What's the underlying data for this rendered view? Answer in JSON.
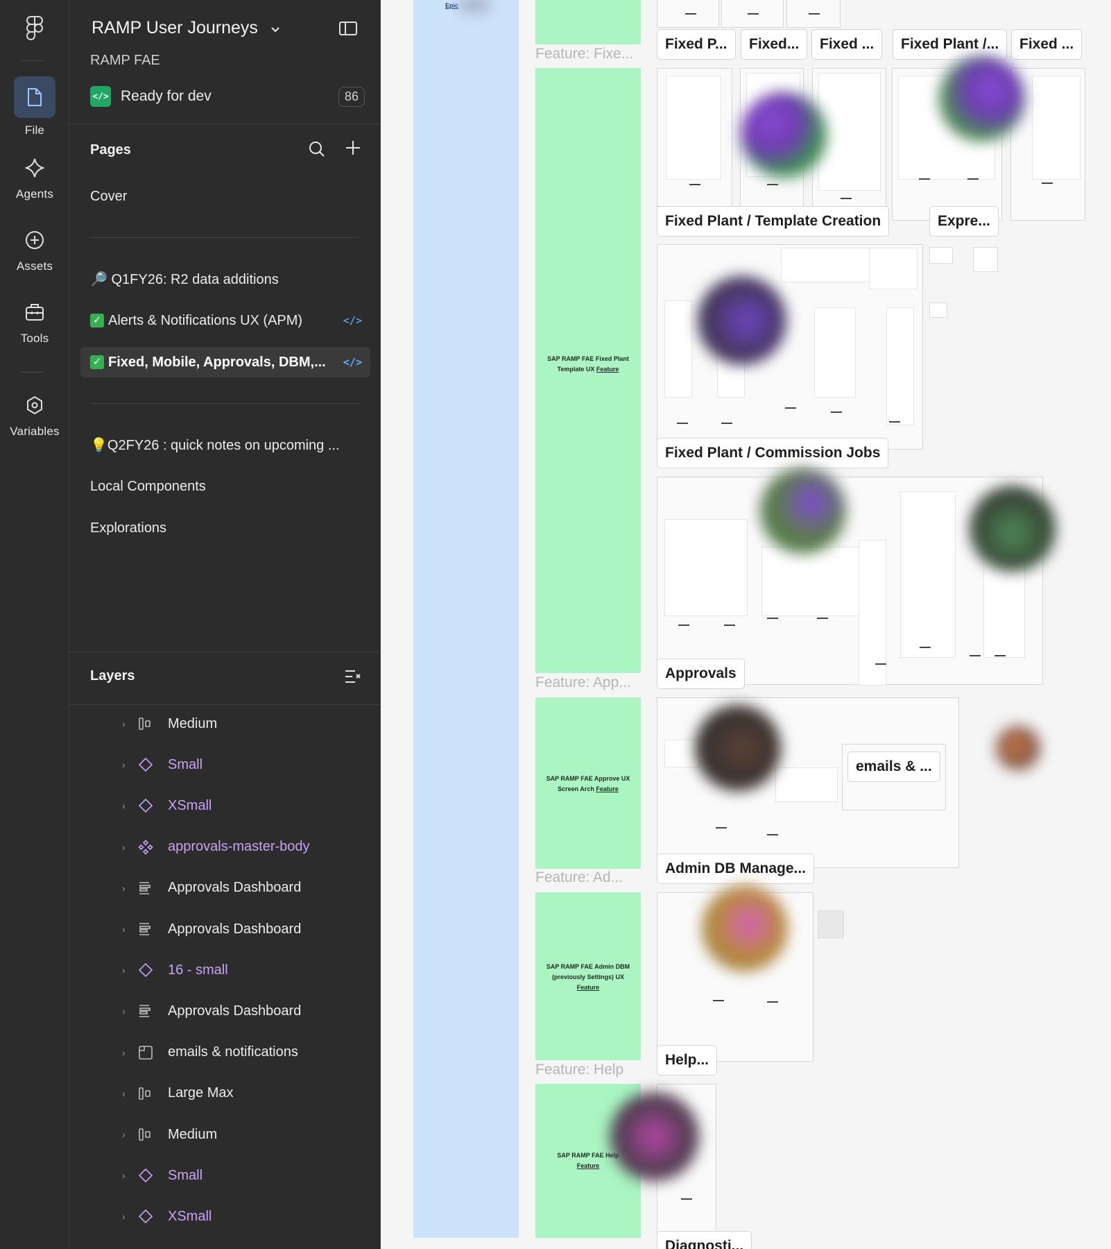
{
  "rail": {
    "items": [
      {
        "label": "File",
        "icon": "file-icon"
      },
      {
        "label": "Agents",
        "icon": "agents-sparkle-icon"
      },
      {
        "label": "Assets",
        "icon": "assets-plus-icon"
      },
      {
        "label": "Tools",
        "icon": "tools-briefcase-icon"
      },
      {
        "label": "Variables",
        "icon": "variables-hexagon-icon"
      }
    ]
  },
  "panel": {
    "project_title": "RAMP User Journeys",
    "team": "RAMP FAE",
    "status_label": "Ready for dev",
    "status_count": "86",
    "pages_header": "Pages",
    "layers_header": "Layers",
    "pages": [
      {
        "label": "Cover"
      },
      {
        "label": "🔎 Q1FY26: R2 data additions"
      },
      {
        "label": "Alerts & Notifications UX (APM)"
      },
      {
        "label": "Fixed, Mobile, Approvals, DBM,..."
      },
      {
        "label": "💡Q2FY26 : quick notes on upcoming ..."
      },
      {
        "label": "Local Components"
      },
      {
        "label": "Explorations"
      }
    ],
    "layers": [
      {
        "label": "Medium",
        "icon": "frame-variant-icon",
        "component": false
      },
      {
        "label": "Small",
        "icon": "component-instance-icon",
        "component": true
      },
      {
        "label": "XSmall",
        "icon": "component-instance-icon",
        "component": true
      },
      {
        "label": "approvals-master-body",
        "icon": "component-set-icon",
        "component": true
      },
      {
        "label": "Approvals Dashboard",
        "icon": "autolayout-icon",
        "component": false
      },
      {
        "label": "Approvals Dashboard",
        "icon": "autolayout-icon",
        "component": false
      },
      {
        "label": "16 - small",
        "icon": "component-instance-icon",
        "component": true
      },
      {
        "label": "Approvals Dashboard",
        "icon": "autolayout-icon",
        "component": false
      },
      {
        "label": "emails & notifications",
        "icon": "section-icon",
        "component": false
      },
      {
        "label": "Large Max",
        "icon": "frame-variant-icon",
        "component": false
      },
      {
        "label": "Medium",
        "icon": "frame-variant-icon",
        "component": false
      },
      {
        "label": "Small",
        "icon": "component-instance-icon",
        "component": true
      },
      {
        "label": "XSmall",
        "icon": "component-instance-icon",
        "component": true
      }
    ]
  },
  "canvas": {
    "epic_label": "Epic",
    "feature_labels": [
      "Feature: Fixe...",
      "Feature: App...",
      "Feature: Ad...",
      "Feature: Help"
    ],
    "feature_blocks": [
      {
        "line1": "SAP RAMP FAE Fixed Plant",
        "line2": "Template UX",
        "link": "Feature"
      },
      {
        "line1": "SAP RAMP FAE Approve UX",
        "line2": "Screen Arch",
        "link": "Feature"
      },
      {
        "line1": "SAP RAMP FAE Admin DBM",
        "line2": "(previously Settings) UX",
        "link": "Feature"
      },
      {
        "line1": "SAP RAMP FAE Help",
        "line2": "",
        "link": "Feature"
      }
    ],
    "frame_titles": {
      "top": [
        "Fixed P...",
        "Fixed...",
        "Fixed ...",
        "Fixed Plant /...",
        "Fixed ..."
      ],
      "template_creation": "Fixed Plant / Template Creation",
      "expre": "Expre...",
      "commission_jobs": "Fixed Plant / Commission Jobs",
      "approvals": "Approvals",
      "emails": "emails & ...",
      "admin_db": "Admin DB Manage...",
      "help": "Help...",
      "diagnostics": "Diagnosti..."
    }
  },
  "colors": {
    "rail_bg": "#2c2c2c",
    "active_item": "#3b4a63",
    "ready_green": "#1ea864",
    "component_purple": "#c9a2f5",
    "epic_blue": "#cce3fb",
    "feature_green": "#aaf5c2"
  }
}
